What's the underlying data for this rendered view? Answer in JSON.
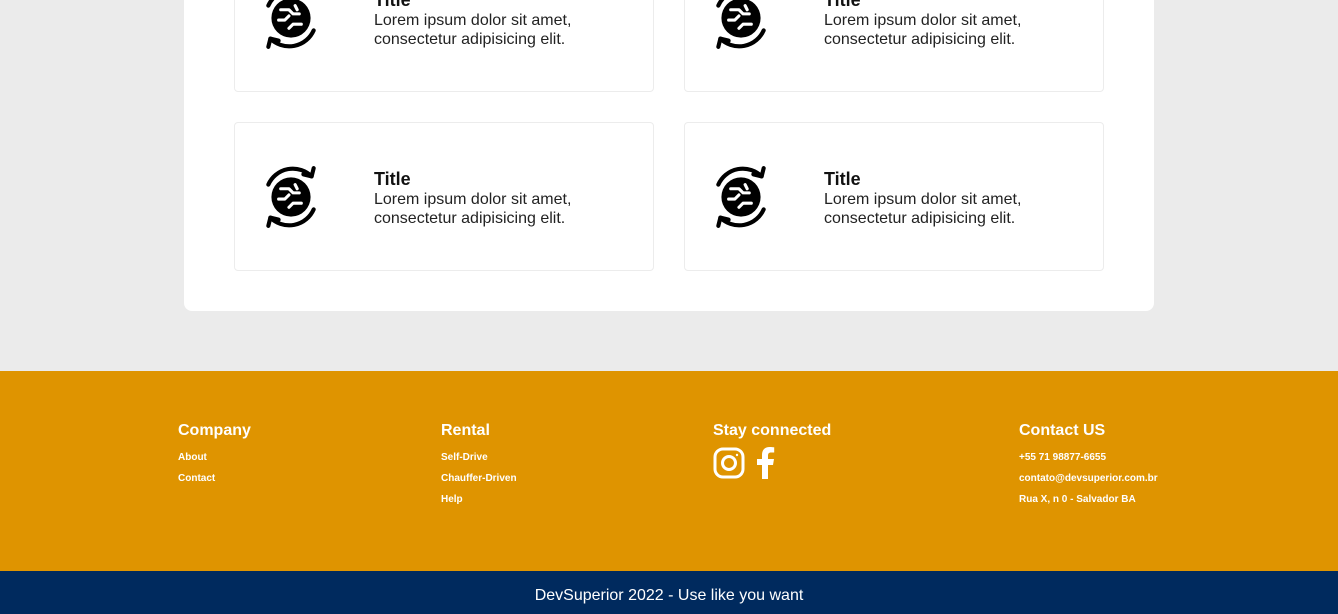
{
  "cards": [
    {
      "icon": "global-refresh-icon",
      "title": "Title",
      "text": "Lorem ipsum dolor sit amet, consectetur adipisicing elit."
    },
    {
      "icon": "global-refresh-icon",
      "title": "Title",
      "text": "Lorem ipsum dolor sit amet, consectetur adipisicing elit."
    },
    {
      "icon": "global-refresh-icon",
      "title": "Title",
      "text": "Lorem ipsum dolor sit amet, consectetur adipisicing elit."
    },
    {
      "icon": "global-refresh-icon",
      "title": "Title",
      "text": "Lorem ipsum dolor sit amet, consectetur adipisicing elit."
    }
  ],
  "footer": {
    "company": {
      "heading": "Company",
      "links": [
        "About",
        "Contact"
      ]
    },
    "rental": {
      "heading": "Rental",
      "links": [
        "Self-Drive",
        "Chauffer-Driven",
        "Help"
      ]
    },
    "social": {
      "heading": "Stay connected",
      "icons": [
        "instagram-icon",
        "facebook-icon"
      ]
    },
    "contact": {
      "heading": "Contact US",
      "items": [
        "+55 71 98877-6655",
        "contato@devsuperior.com.br",
        "Rua X, n 0 - Salvador BA"
      ]
    }
  },
  "copyright": "DevSuperior 2022 - Use like you want",
  "colors": {
    "background": "#ebebeb",
    "footer": "#df9400",
    "bottom_bar": "#002a5e"
  }
}
